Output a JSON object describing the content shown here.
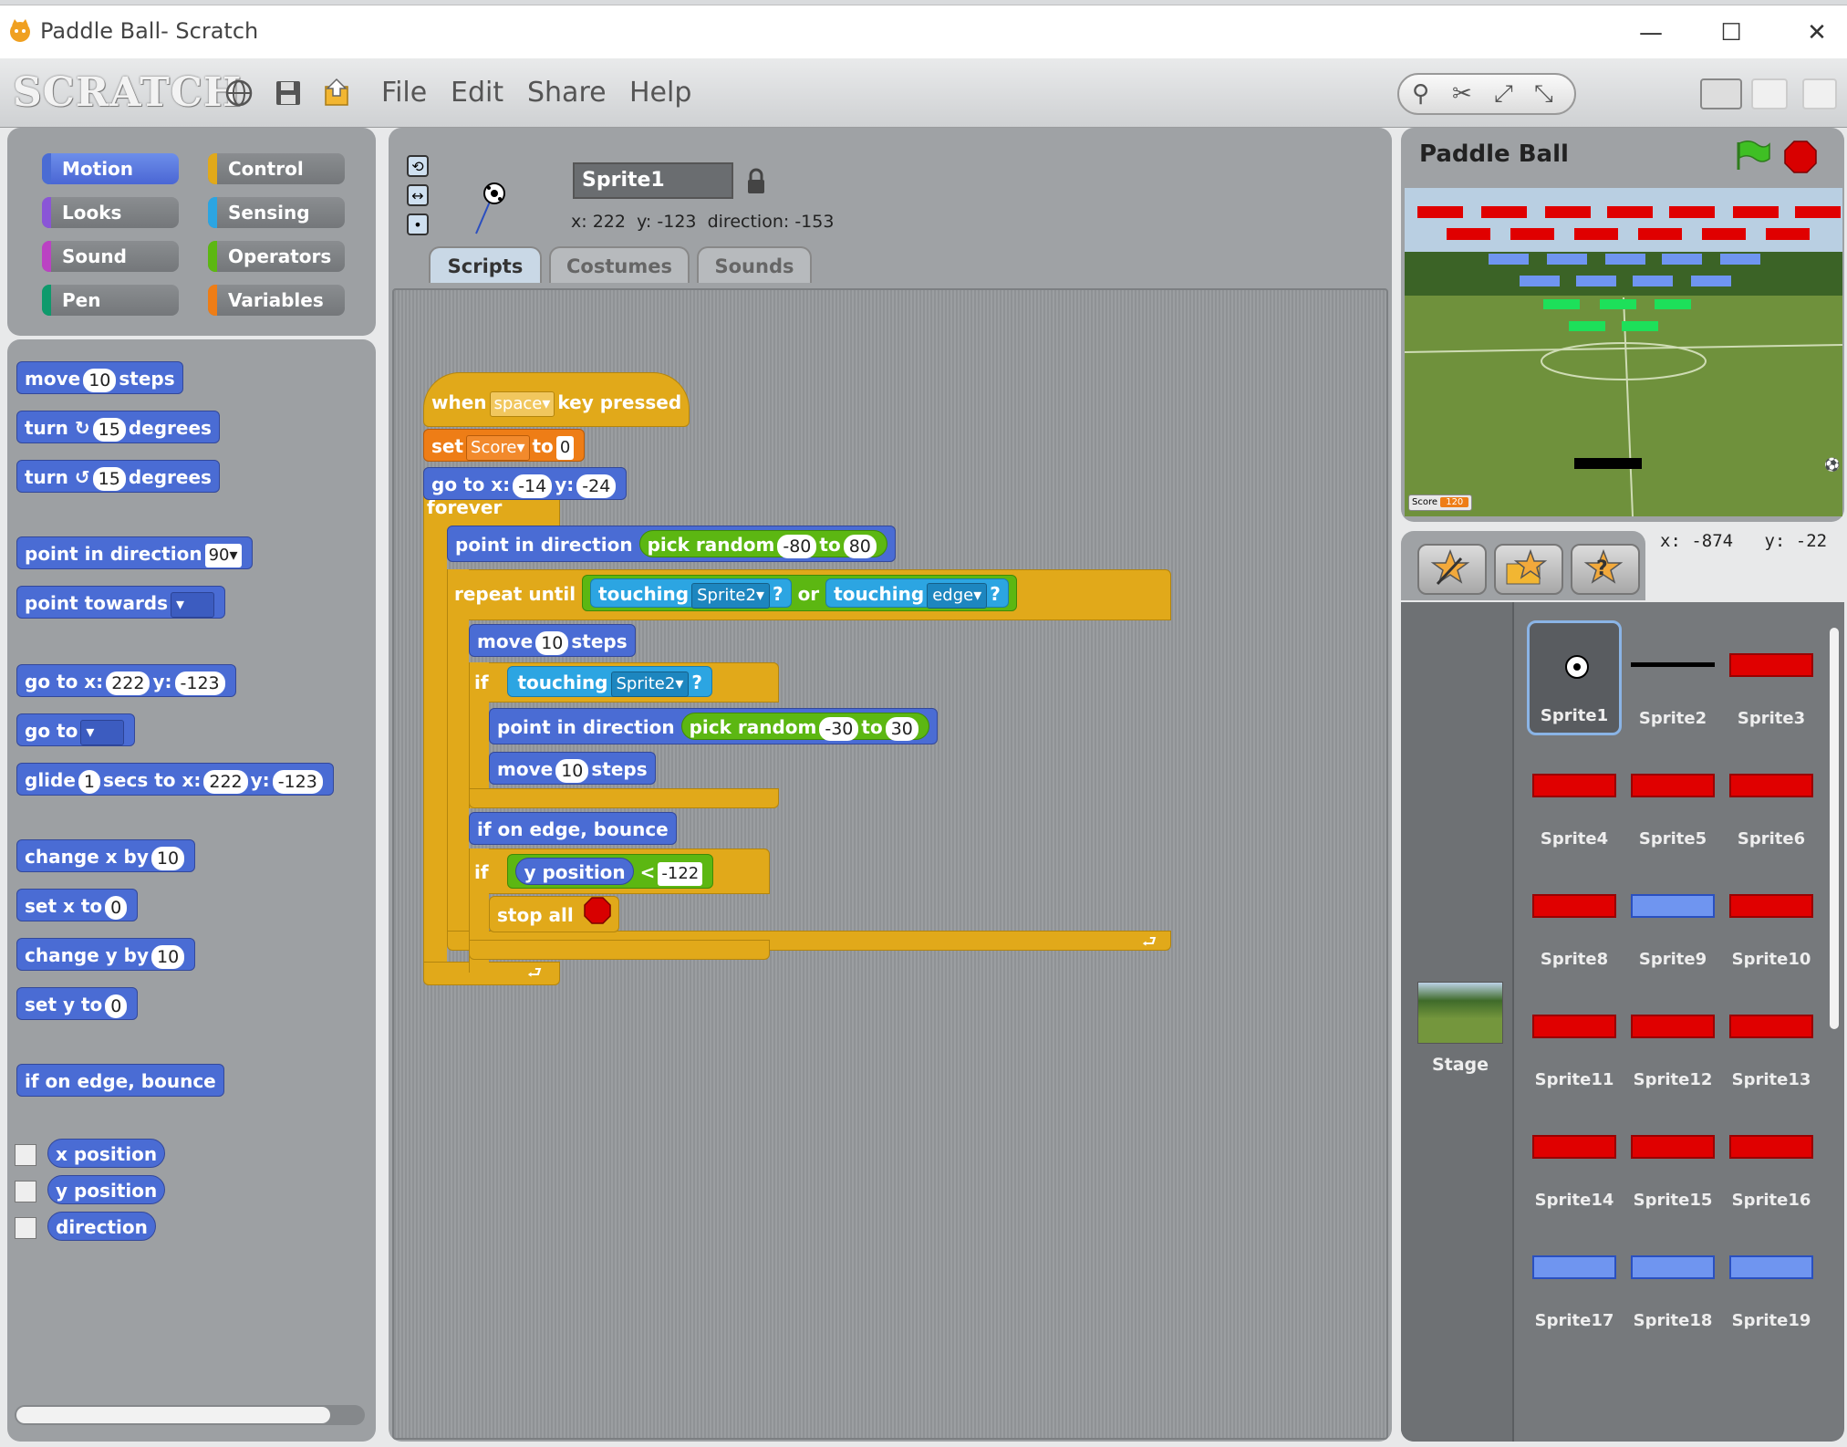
{
  "window": {
    "title": "Paddle Ball- Scratch"
  },
  "menubar": {
    "logo": "SCRATCH",
    "menus": [
      "File",
      "Edit",
      "Share",
      "Help"
    ]
  },
  "categories": [
    {
      "label": "Motion",
      "color": "#4a6cd4"
    },
    {
      "label": "Control",
      "color": "#e1a91a"
    },
    {
      "label": "Looks",
      "color": "#8a55d7"
    },
    {
      "label": "Sensing",
      "color": "#2ca5e2"
    },
    {
      "label": "Sound",
      "color": "#bb42c3"
    },
    {
      "label": "Operators",
      "color": "#5cb712"
    },
    {
      "label": "Pen",
      "color": "#0e9a6c"
    },
    {
      "label": "Variables",
      "color": "#ee7d16"
    }
  ],
  "palette": {
    "move": {
      "a": "move",
      "n": "10",
      "b": "steps"
    },
    "turn_cw": {
      "a": "turn",
      "n": "15",
      "b": "degrees"
    },
    "turn_ccw": {
      "a": "turn",
      "n": "15",
      "b": "degrees"
    },
    "point_dir": {
      "a": "point in direction",
      "v": "90"
    },
    "point_towards": {
      "a": "point towards"
    },
    "goto_xy": {
      "a": "go to x:",
      "x": "222",
      "b": "y:",
      "y": "-123"
    },
    "goto": {
      "a": "go to"
    },
    "glide": {
      "a": "glide",
      "s": "1",
      "b": "secs to x:",
      "x": "222",
      "c": "y:",
      "y": "-123"
    },
    "change_x": {
      "a": "change x by",
      "n": "10"
    },
    "set_x": {
      "a": "set x to",
      "n": "0"
    },
    "change_y": {
      "a": "change y by",
      "n": "10"
    },
    "set_y": {
      "a": "set y to",
      "n": "0"
    },
    "bounce": "if on edge, bounce",
    "reporters": [
      "x position",
      "y position",
      "direction"
    ]
  },
  "sprite_info": {
    "name": "Sprite1",
    "x_label": "x:",
    "x": "222",
    "y_label": "y:",
    "y": "-123",
    "dir_label": "direction:",
    "dir": "-153"
  },
  "tabs": [
    "Scripts",
    "Costumes",
    "Sounds"
  ],
  "script": {
    "hat": {
      "a": "when",
      "key": "space",
      "b": "key pressed"
    },
    "set": {
      "a": "set",
      "var": "Score",
      "b": "to",
      "v": "0"
    },
    "goto": {
      "a": "go to x:",
      "x": "-14",
      "b": "y:",
      "y": "-24"
    },
    "forever": "forever",
    "point1": {
      "a": "point in direction",
      "op": "pick random",
      "lo": "-80",
      "to": "to",
      "hi": "80"
    },
    "repeat": {
      "a": "repeat until",
      "t1": "touching",
      "s1": "Sprite2",
      "q": "?",
      "or": "or",
      "t2": "touching",
      "s2": "edge"
    },
    "move1": {
      "a": "move",
      "n": "10",
      "b": "steps"
    },
    "if1": {
      "a": "if",
      "t": "touching",
      "s": "Sprite2",
      "q": "?"
    },
    "point2": {
      "a": "point in direction",
      "op": "pick random",
      "lo": "-30",
      "to": "to",
      "hi": "30"
    },
    "move2": {
      "a": "move",
      "n": "10",
      "b": "steps"
    },
    "bounce": "if on edge, bounce",
    "if2": {
      "a": "if",
      "r": "y position",
      "lt": "<",
      "v": "-122"
    },
    "stop": "stop all"
  },
  "stage": {
    "title": "Paddle Ball",
    "score_label": "Score",
    "score_value": "120",
    "coords": {
      "x_label": "x:",
      "x": "-874",
      "y_label": "y:",
      "y": "-22"
    }
  },
  "sprites": [
    {
      "name": "Sprite1",
      "kind": "ball"
    },
    {
      "name": "Sprite2",
      "kind": "paddle"
    },
    {
      "name": "Sprite3",
      "kind": "red"
    },
    {
      "name": "Sprite4",
      "kind": "red"
    },
    {
      "name": "Sprite5",
      "kind": "red"
    },
    {
      "name": "Sprite6",
      "kind": "red"
    },
    {
      "name": "Sprite8",
      "kind": "red"
    },
    {
      "name": "Sprite9",
      "kind": "blue"
    },
    {
      "name": "Sprite10",
      "kind": "red"
    },
    {
      "name": "Sprite11",
      "kind": "red"
    },
    {
      "name": "Sprite12",
      "kind": "red"
    },
    {
      "name": "Sprite13",
      "kind": "red"
    },
    {
      "name": "Sprite14",
      "kind": "red"
    },
    {
      "name": "Sprite15",
      "kind": "red"
    },
    {
      "name": "Sprite16",
      "kind": "red"
    },
    {
      "name": "Sprite17",
      "kind": "blue"
    },
    {
      "name": "Sprite18",
      "kind": "blue"
    },
    {
      "name": "Sprite19",
      "kind": "blue"
    }
  ],
  "stage_item": "Stage",
  "colors": {
    "red_brick": "#e00000",
    "blue_brick": "#6f95f0",
    "green_brick": "#1de05a"
  }
}
